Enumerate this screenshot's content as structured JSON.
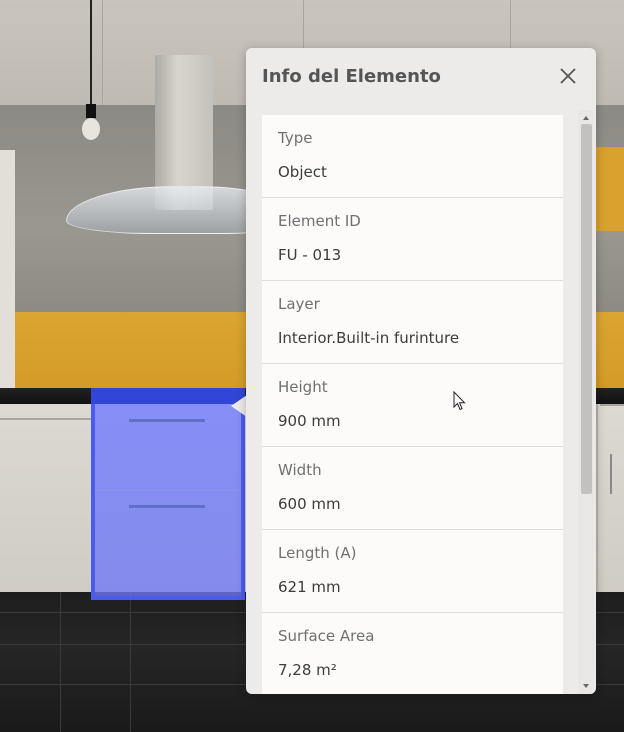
{
  "panel": {
    "title": "Info del Elemento",
    "close_icon": "close-icon"
  },
  "properties": [
    {
      "label": "Type",
      "value": "Object"
    },
    {
      "label": "Element ID",
      "value": "FU - 013"
    },
    {
      "label": "Layer",
      "value": "Interior.Built-in furinture"
    },
    {
      "label": "Height",
      "value": "900 mm"
    },
    {
      "label": "Width",
      "value": "600 mm"
    },
    {
      "label": "Length (A)",
      "value": "621 mm"
    },
    {
      "label": "Surface Area",
      "value": "7,28 m²"
    }
  ],
  "colors": {
    "selection": "#4a5cf0",
    "panel_bg": "#ecebea",
    "backsplash": "#d9a12d"
  }
}
